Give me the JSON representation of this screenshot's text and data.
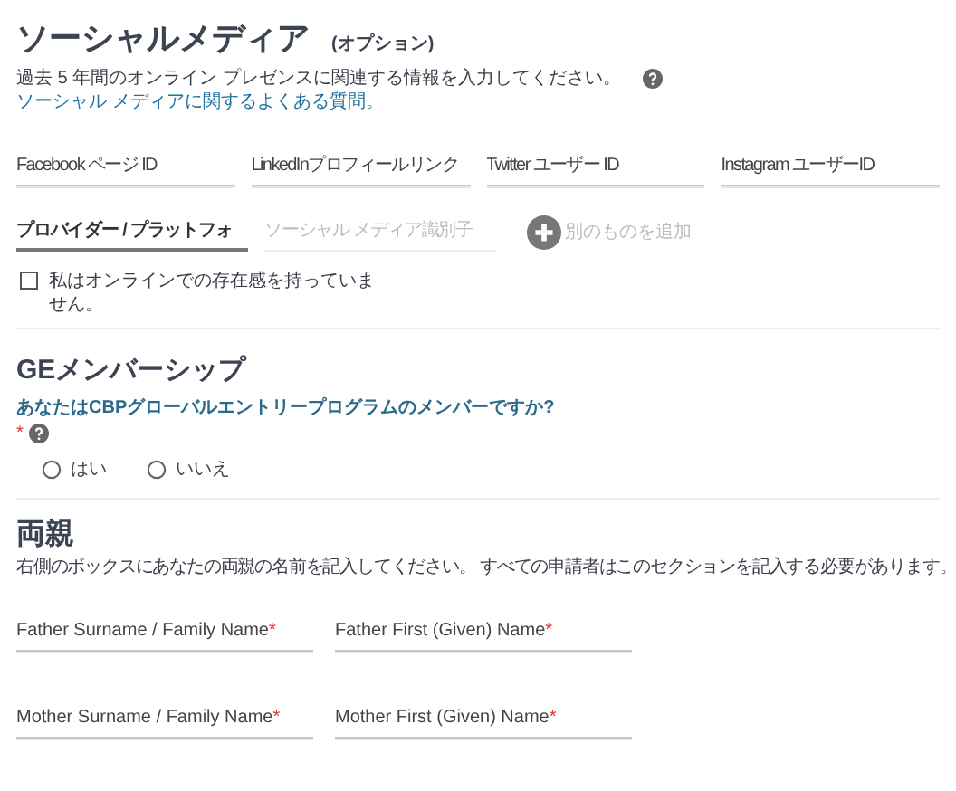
{
  "social_media": {
    "title": "ソーシャルメディア",
    "title_note": "(オプション)",
    "description": "過去 5 年間のオンライン プレゼンスに関連する情報を入力してください。",
    "faq_link": "ソーシャル メディアに関するよくある質問。",
    "fields": [
      {
        "placeholder": "Facebook ページ ID"
      },
      {
        "placeholder": "LinkedInプロフィールリンク"
      },
      {
        "placeholder": "Twitter ユーザー ID"
      },
      {
        "placeholder": "Instagram ユーザーID"
      }
    ],
    "provider": {
      "value": "プロバイダー / プラットフォ"
    },
    "identifier": {
      "placeholder": "ソーシャル メディア識別子",
      "disabled": true
    },
    "add_button": {
      "label": "別のものを追加",
      "disabled": true
    },
    "no_presence": {
      "label": "私はオンラインでの存在感を持っていません。",
      "checked": false
    }
  },
  "ge_membership": {
    "title": "GEメンバーシップ",
    "question": "あなたはCBPグローバルエントリープログラムのメンバーですか?",
    "required_mark": "*",
    "options": [
      {
        "label": "はい",
        "selected": false
      },
      {
        "label": "いいえ",
        "selected": false
      }
    ]
  },
  "parents": {
    "title": "両親",
    "description": "右側のボックスにあなたの両親の名前を記入してください。 すべての申請者はこのセクションを記入する必要があります。",
    "fields": [
      {
        "label": "Father Surname / Family Name",
        "mark": "*"
      },
      {
        "label": "Father First (Given) Name",
        "mark": "*"
      },
      {
        "label": "Mother Surname / Family Name",
        "mark": "*"
      },
      {
        "label": "Mother First (Given) Name",
        "mark": "*"
      }
    ]
  }
}
